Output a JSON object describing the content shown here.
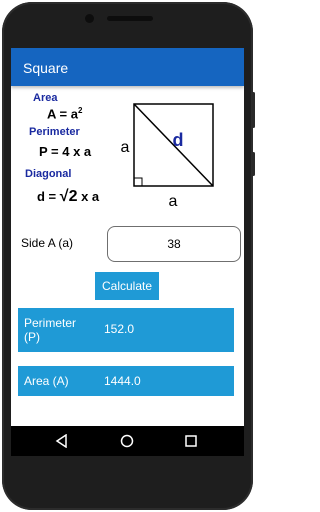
{
  "app": {
    "title": "Square"
  },
  "formulas": {
    "area_label": "Area",
    "area_formula": "A = a",
    "area_exponent": "2",
    "perimeter_label": "Perimeter",
    "perimeter_formula": "P = 4 x a",
    "diagonal_label": "Diagonal",
    "diagonal_prefix": "d =",
    "diagonal_radical": "√2",
    "diagonal_suffix": "x a"
  },
  "diagram": {
    "side_left": "a",
    "side_bottom": "a",
    "diagonal": "d"
  },
  "input": {
    "label": "Side A (a)",
    "value": "38"
  },
  "calculate_label": "Calculate",
  "results": [
    {
      "label": "Perimeter (P)",
      "value": "152.0"
    },
    {
      "label": "Area (A)",
      "value": "1444.0"
    }
  ],
  "colors": {
    "appbar": "#1565c0",
    "accent": "#1f9ad6",
    "label_blue": "#1a2aa0",
    "diagonal_color": "#1a2aa0"
  },
  "icons": {
    "back": "triangle-back-icon",
    "home": "circle-home-icon",
    "recents": "square-recents-icon"
  }
}
